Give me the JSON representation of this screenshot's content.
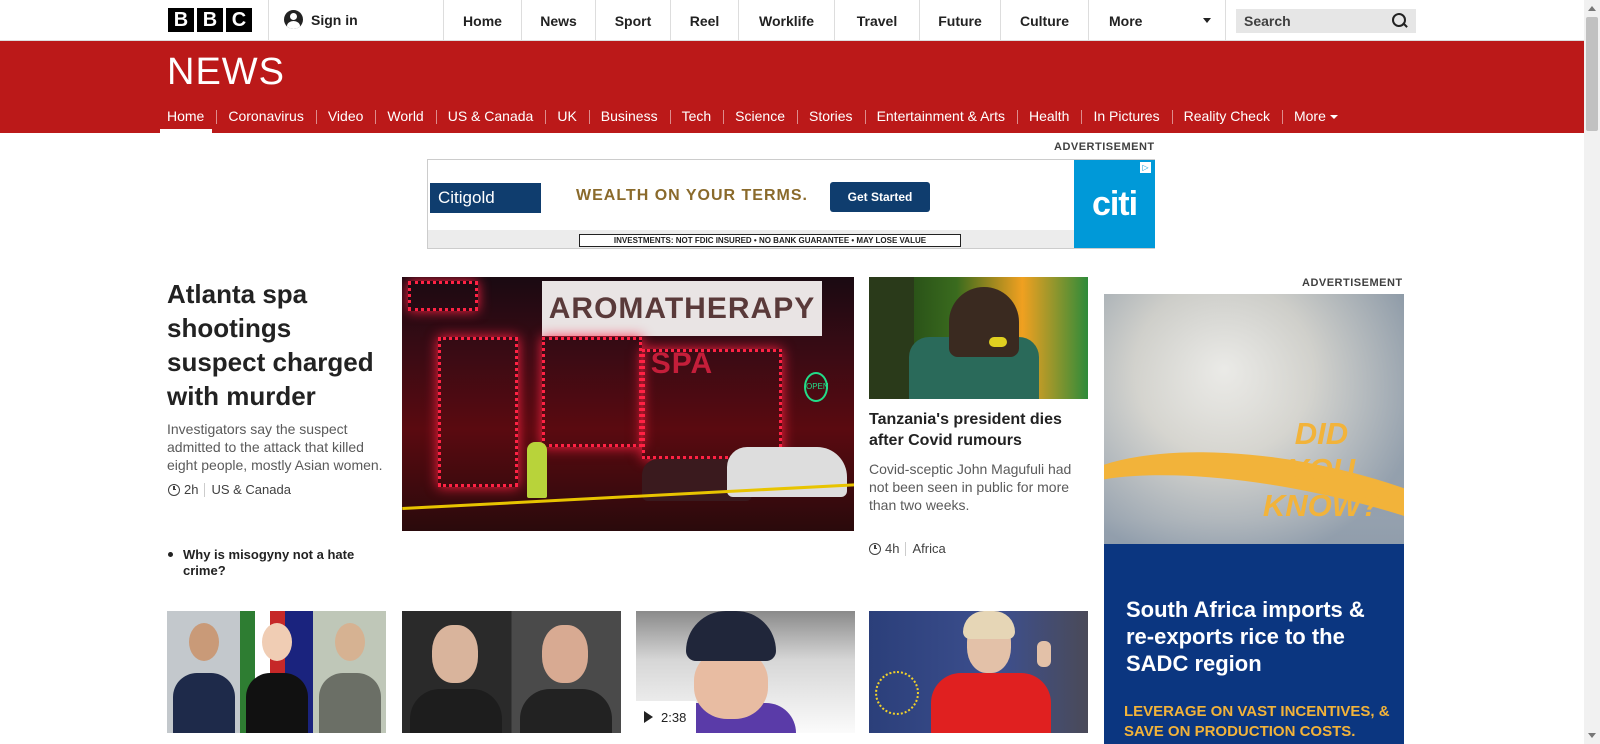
{
  "topbar": {
    "logo_letters": [
      "B",
      "B",
      "C"
    ],
    "sign_in": "Sign in",
    "nav": [
      "Home",
      "News",
      "Sport",
      "Reel",
      "Worklife",
      "Travel",
      "Future",
      "Culture"
    ],
    "more": "More",
    "search_placeholder": "Search"
  },
  "news": {
    "logo": "NEWS",
    "subnav": [
      "Home",
      "Coronavirus",
      "Video",
      "World",
      "US & Canada",
      "UK",
      "Business",
      "Tech",
      "Science",
      "Stories",
      "Entertainment & Arts",
      "Health",
      "In Pictures",
      "Reality Check"
    ],
    "more": "More",
    "active": "Home"
  },
  "ads": {
    "label": "ADVERTISEMENT",
    "banner": {
      "brand": "Citigold",
      "headline": "WEALTH ON YOUR TERMS.",
      "cta": "Get Started",
      "disclaimer": "INVESTMENTS: NOT FDIC INSURED • NO BANK GUARANTEE • MAY LOSE VALUE",
      "logo": "citi"
    },
    "side": {
      "did_you_know": [
        "DID",
        "YOU",
        "KNOW?"
      ],
      "headline": "South Africa imports & re-exports rice to the SADC region",
      "tagline": "LEVERAGE ON VAST INCENTIVES, & SAVE ON PRODUCTION COSTS."
    }
  },
  "lead": {
    "title": "Atlanta spa shootings suspect charged with murder",
    "summary": "Investigators say the suspect admitted to the attack that killed eight people, mostly Asian women.",
    "time": "2h",
    "section": "US & Canada",
    "related": "Why is misogyny not a hate crime?",
    "image_sign": "AROMATHERAPY",
    "image_sign_accent": "SPA",
    "image_open": "OPEN"
  },
  "second": {
    "title": "Tanzania's president dies after Covid rumours",
    "summary": "Covid-sceptic John Magufuli had not been seen in public for more than two weeks.",
    "time": "4h",
    "section": "Africa"
  },
  "bottom": {
    "video_duration": "2:38"
  }
}
